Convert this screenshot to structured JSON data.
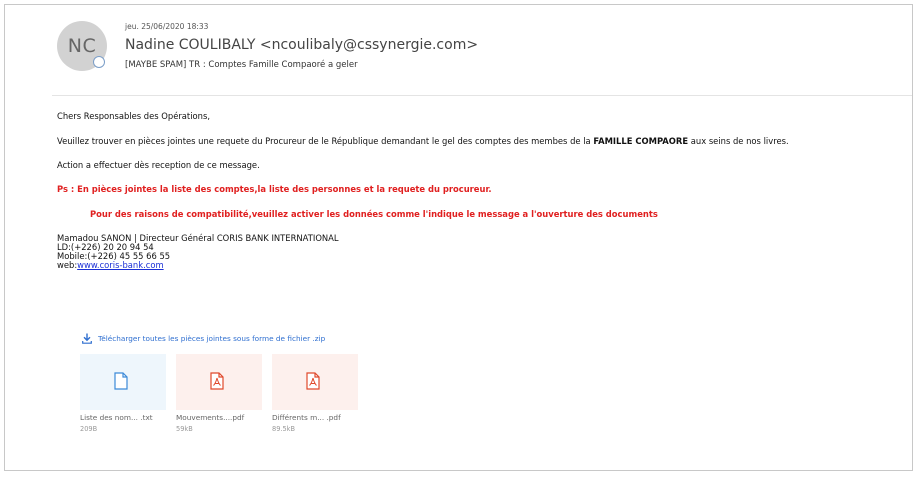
{
  "email": {
    "avatar_initials": "NC",
    "date": "jeu. 25/06/2020 18:33",
    "sender": "Nadine COULIBALY <ncoulibaly@cssynergie.com>",
    "subject": "[MAYBE SPAM]  TR : Comptes Famille Compaoré a geler"
  },
  "body": {
    "greeting": "Chers Responsables des Opérations,",
    "para1_before": "Veuillez trouver en pièces jointes une requete du Procureur de le République demandant le gel des comptes des membes de la ",
    "para1_bold": "FAMILLE COMPAORE",
    "para1_after": " aux seins de nos livres.",
    "para2": "Action a effectuer dès reception de ce message.",
    "ps": "Ps : En pièces jointes la liste des comptes,la liste des personnes et la requete du procureur.",
    "notice": "Pour des raisons de compatibilité,veuillez activer les données comme l'indique le message a l'ouverture des documents"
  },
  "signature": {
    "line1": "Mamadou SANON | Directeur Général CORIS BANK INTERNATIONAL",
    "line2": "LD:(+226) 20 20 94 54",
    "line3": "Mobile:(+226) 45 55 66 55",
    "web_label": "web:",
    "web_link": "www.coris-bank.com"
  },
  "download_all": "Télécharger toutes les pièces jointes sous forme de fichier .zip",
  "attachments": [
    {
      "name": "Liste des nom... .txt",
      "size": "209B",
      "icon": "text-file-icon"
    },
    {
      "name": "Mouvements....pdf",
      "size": "59kB",
      "icon": "pdf-icon"
    },
    {
      "name": "Différents m... .pdf",
      "size": "89.5kB",
      "icon": "pdf-icon"
    }
  ],
  "colors": {
    "accent_blue": "#2f6fd0",
    "alert_red": "#e02020",
    "link_blue": "#1a2fd6",
    "pdf_red": "#e0492c"
  }
}
